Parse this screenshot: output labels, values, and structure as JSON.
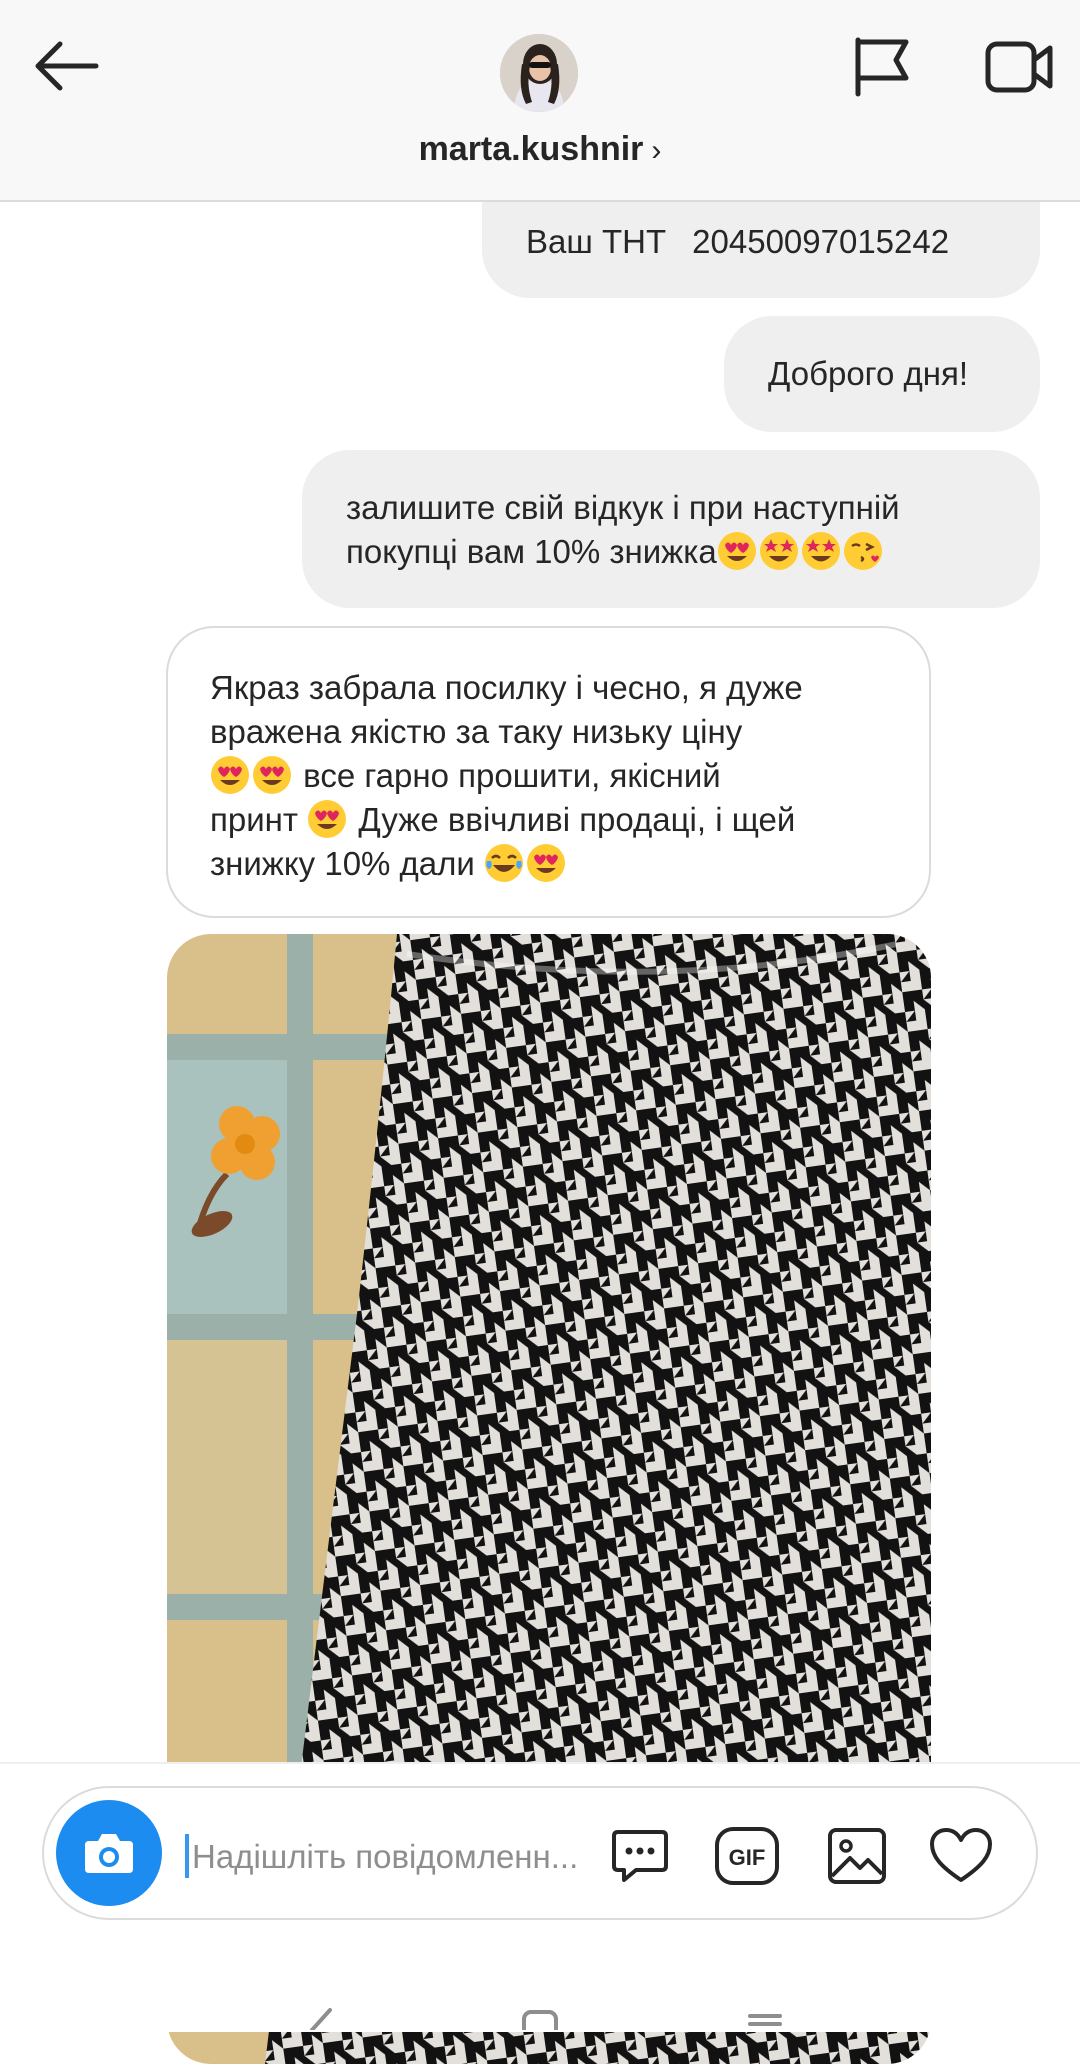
{
  "header": {
    "username": "marta.kushnir",
    "username_chevron": "›",
    "back_icon": "arrow-left-icon",
    "flag_icon": "flag-icon",
    "video_icon": "video-camera-icon"
  },
  "messages": [
    {
      "direction": "outgoing",
      "text_part1": "Ваш ТНТ",
      "text_part2": "20450097015242"
    },
    {
      "direction": "outgoing",
      "text": "Доброго дня!"
    },
    {
      "direction": "outgoing",
      "line1": "залишите свій відкук і при  наступній",
      "line2_text": "покупці вам 10% знижка",
      "line2_emojis": [
        "heart-eyes",
        "star-struck",
        "star-struck",
        "face-blowing-kiss"
      ]
    },
    {
      "direction": "incoming",
      "line1": "Якраз забрала посилку і чесно,  я дуже",
      "line2": "вражена якістю за таку низьку ціну",
      "line3_text": "все гарно прошити,  якісний",
      "line4_prefix": "принт",
      "line4_suffix": "Дуже ввічливі продаці,  і щей",
      "line5_text": "знижку 10% дали",
      "emojis": [
        "heart-eyes",
        "heart-eyes",
        "heart-eyes",
        "tears-of-joy",
        "heart-eyes"
      ]
    },
    {
      "direction": "incoming",
      "type": "photo",
      "subject": "houndstooth-fabric-photo"
    }
  ],
  "composer": {
    "placeholder": "Надішліть повідомленн...",
    "value": "",
    "camera_icon": "camera-icon",
    "sticker_icon": "speech-bubble-dots-icon",
    "gif_label": "GIF",
    "gallery_icon": "image-gallery-icon",
    "like_icon": "heart-icon"
  },
  "colors": {
    "header_bg": "#f8f8f8",
    "outgoing_bubble": "#efefef",
    "incoming_border": "#dbdbdb",
    "camera_button": "#1d8cf0",
    "text": "#262626",
    "placeholder": "#8e8e8e"
  }
}
